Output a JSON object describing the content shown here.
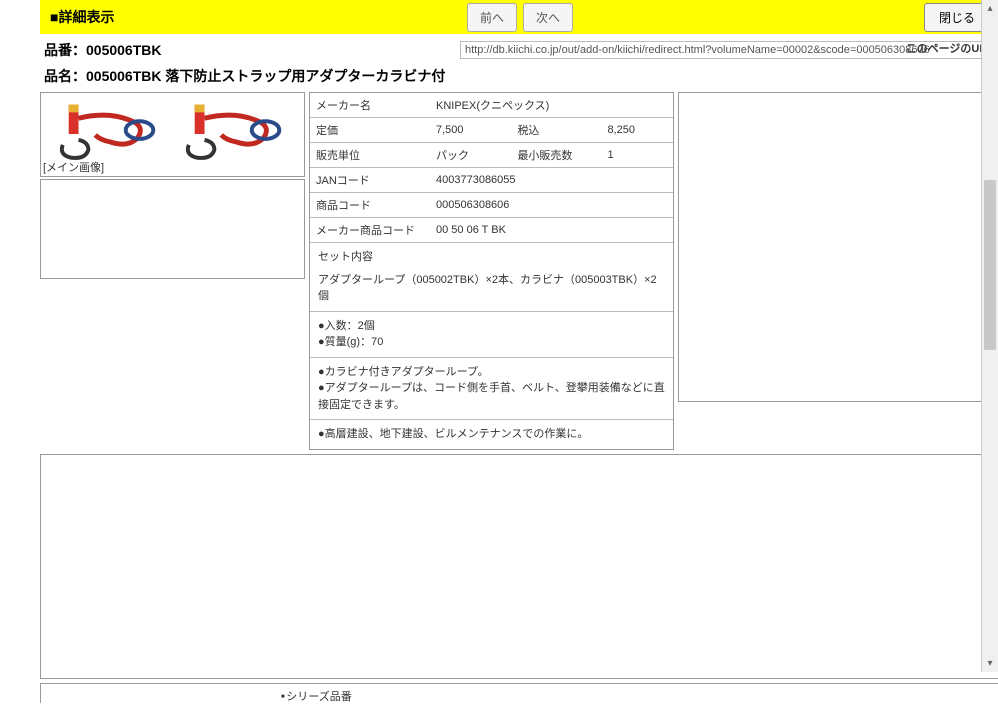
{
  "header": {
    "title": "■詳細表示",
    "prev": "前へ",
    "next": "次へ",
    "close": "閉じる"
  },
  "url_section": {
    "label": "このページのURL",
    "value": "http://db.kiichi.co.jp/out/add-on/kiichi/redirect.html?volumeName=00002&scode=000506308606"
  },
  "product": {
    "code_label": "品番：",
    "code": "005006TBK",
    "name_label": "品名：",
    "name": "005006TBK 落下防止ストラップ用アダプターカラビナ付"
  },
  "image": {
    "caption": "[メイン画像]"
  },
  "specs": {
    "maker_label": "メーカー名",
    "maker_value": "KNIPEX(クニペックス)",
    "price_label": "定価",
    "price_value": "7,500",
    "tax_label": "税込",
    "tax_value": "8,250",
    "unit_label": "販売単位",
    "unit_value": "パック",
    "minqty_label": "最小販売数",
    "minqty_value": "1",
    "jan_label": "JANコード",
    "jan_value": "4003773086055",
    "prodcode_label": "商品コード",
    "prodcode_value": "000506308606",
    "makercode_label": "メーカー商品コード",
    "makercode_value": "00 50 06 T BK"
  },
  "set_content": {
    "title": "セット内容",
    "body": "アダプターループ（005002TBK）×2本、カラビナ（005003TBK）×2個"
  },
  "bullets1": "●入数：2個\n●質量(g)：70",
  "bullets2": "●カラビナ付きアダプターループ。\n●アダプターループは、コード側を手首、ベルト、登攀用装備などに直接固定できます。",
  "bullets3": "●高層建設、地下建設、ビルメンテナンスでの作業に。",
  "bottom_item": "シリーズ品番"
}
